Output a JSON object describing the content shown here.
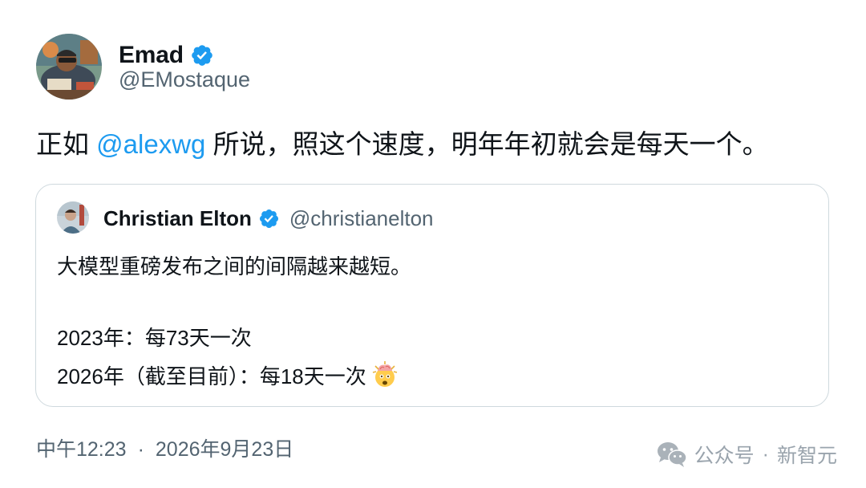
{
  "author": {
    "name": "Emad",
    "handle": "@EMostaque",
    "verified": true
  },
  "tweet": {
    "text_before": "正如 ",
    "mention": "@alexwg",
    "text_after": " 所说，照这个速度，明年年初就会是每天一个。"
  },
  "quote": {
    "name": "Christian Elton",
    "handle": "@christianelton",
    "verified": true,
    "line1": "大模型重磅发布之间的间隔越来越短。",
    "line2": "2023年：每73天一次",
    "line3": "2026年（截至目前）：每18天一次",
    "emoji": "exploding-head"
  },
  "footer": {
    "time": "中午12:23",
    "separator": "·",
    "date": "2026年9月23日"
  },
  "watermark": {
    "icon": "wechat-icon",
    "source": "公众号",
    "separator": "·",
    "brand": "新智元"
  },
  "colors": {
    "link": "#1d9bf0",
    "verified": "#1d9bf0",
    "secondary_text": "#536471",
    "border": "#cfd9de"
  }
}
